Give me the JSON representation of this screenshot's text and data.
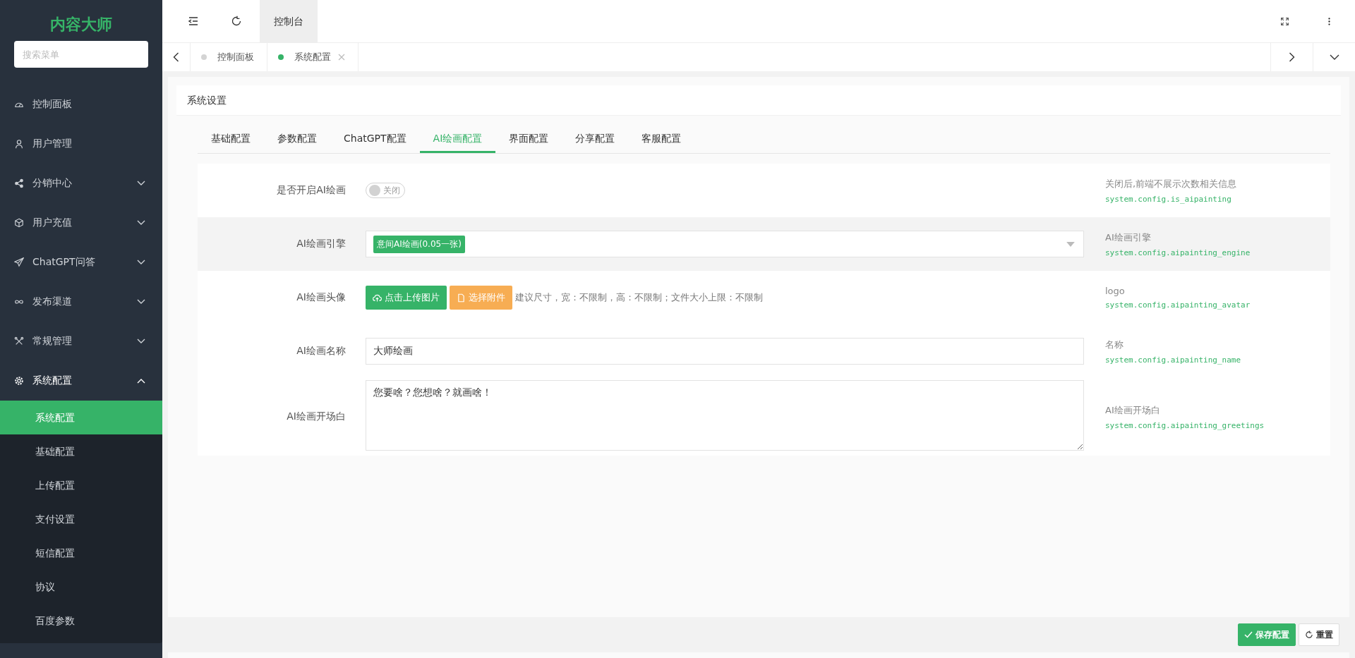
{
  "sidebar": {
    "logo": "内容大师",
    "search": {
      "placeholder": "搜索菜单"
    },
    "items": [
      {
        "label": "控制面板",
        "expandable": false,
        "expanded": false
      },
      {
        "label": "用户管理",
        "expandable": false,
        "expanded": false
      },
      {
        "label": "分销中心",
        "expandable": true,
        "expanded": false
      },
      {
        "label": "用户充值",
        "expandable": true,
        "expanded": false
      },
      {
        "label": "ChatGPT问答",
        "expandable": true,
        "expanded": false
      },
      {
        "label": "发布渠道",
        "expandable": true,
        "expanded": false
      },
      {
        "label": "常规管理",
        "expandable": true,
        "expanded": false
      },
      {
        "label": "系统配置",
        "expandable": true,
        "expanded": true,
        "children": [
          {
            "label": "系统配置",
            "selected": true
          },
          {
            "label": "基础配置",
            "selected": false
          },
          {
            "label": "上传配置",
            "selected": false
          },
          {
            "label": "支付设置",
            "selected": false
          },
          {
            "label": "短信配置",
            "selected": false
          },
          {
            "label": "协议",
            "selected": false
          },
          {
            "label": "百度参数",
            "selected": false
          }
        ]
      }
    ]
  },
  "topbar": {
    "tabs": [
      {
        "label": "控制台",
        "selected": true
      }
    ]
  },
  "page_tabs": [
    {
      "label": "控制面板",
      "selected": false,
      "closable": false
    },
    {
      "label": "系统配置",
      "selected": true,
      "closable": true
    }
  ],
  "card": {
    "title": "系统设置",
    "tabs": [
      {
        "label": "基础配置",
        "selected": false
      },
      {
        "label": "参数配置",
        "selected": false
      },
      {
        "label": "ChatGPT配置",
        "selected": false
      },
      {
        "label": "AI绘画配置",
        "selected": true
      },
      {
        "label": "界面配置",
        "selected": false
      },
      {
        "label": "分享配置",
        "selected": false
      },
      {
        "label": "客服配置",
        "selected": false
      }
    ],
    "fields": [
      {
        "kind": "switch",
        "label": "是否开启AI绘画",
        "on": false,
        "switch_text": "关闭",
        "highlighted": false,
        "help": "关闭后,前端不展示次数相关信息",
        "key": "system.config.is_aipainting"
      },
      {
        "kind": "select",
        "label": "AI绘画引擎",
        "tag": "意间AI绘画(0.05一张)",
        "highlighted": true,
        "help": "AI绘画引擎",
        "key": "system.config.aipainting_engine"
      },
      {
        "kind": "upload",
        "label": "AI绘画头像",
        "upload_button": "点击上传图片",
        "attach_button": "选择附件",
        "hint": "建议尺寸，宽：不限制，高：不限制；文件大小上限：不限制",
        "highlighted": false,
        "help": "logo",
        "key": "system.config.aipainting_avatar"
      },
      {
        "kind": "input",
        "label": "AI绘画名称",
        "value": "大师绘画",
        "highlighted": false,
        "help": "名称",
        "key": "system.config.aipainting_name"
      },
      {
        "kind": "textarea",
        "label": "AI绘画开场白",
        "value": "您要啥？您想啥？就画啥！",
        "highlighted": false,
        "help": "AI绘画开场白",
        "key": "system.config.aipainting_greetings"
      }
    ]
  },
  "footer": {
    "buttons": [
      {
        "label": "保存配置",
        "kind": "primary"
      },
      {
        "label": "重置",
        "kind": "default"
      }
    ]
  }
}
